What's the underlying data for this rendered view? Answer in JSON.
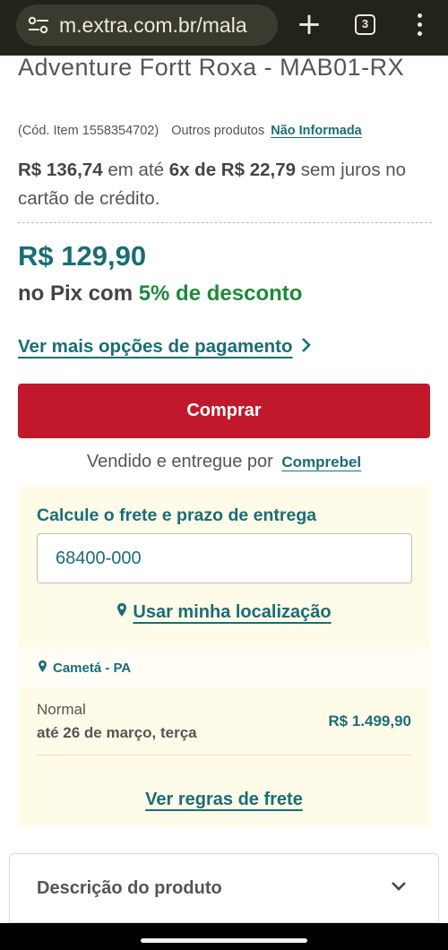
{
  "browser": {
    "url": "m.extra.com.br/mala",
    "tab_count": "3",
    "new_tab_label": "+"
  },
  "product": {
    "title": "Adventure Fortt Roxa - MAB01-RX",
    "code": "(Cód. Item 1558354702)",
    "others_label": "Outros produtos",
    "brand": "Não Informada"
  },
  "pricing": {
    "price": "R$ 136,74",
    "installment_mid": "em até",
    "installment_terms": "6x de R$ 22,79",
    "installment_suffix": "sem juros no cartão de crédito.",
    "pix_price": "R$ 129,90",
    "pix_prefix": "no Pix com",
    "pix_discount": "5% de desconto",
    "more_options": "Ver mais opções de pagamento"
  },
  "buy_button": "Comprar",
  "seller": {
    "label": "Vendido e entregue por",
    "name": "Comprebel"
  },
  "shipping": {
    "title": "Calcule o frete e prazo de entrega",
    "cep_value": "68400-000",
    "use_location": "Usar minha localização",
    "city": "Cametá - PA",
    "options": [
      {
        "name": "Normal",
        "date": "até 26 de março, terça",
        "price": "R$ 1.499,90"
      }
    ],
    "rules_link": "Ver regras de frete"
  },
  "description": {
    "label": "Descrição do produto"
  },
  "colors": {
    "teal": "#1a6d76",
    "buy_red": "#c2182b",
    "pix_green": "#1f8a3a",
    "shipping_bg": "#fffbe9"
  },
  "icons": [
    "tune-icon",
    "plus-icon",
    "tabs-icon",
    "more-vert-icon",
    "chevron-right-icon",
    "location-pin-icon",
    "chevron-down-icon"
  ]
}
